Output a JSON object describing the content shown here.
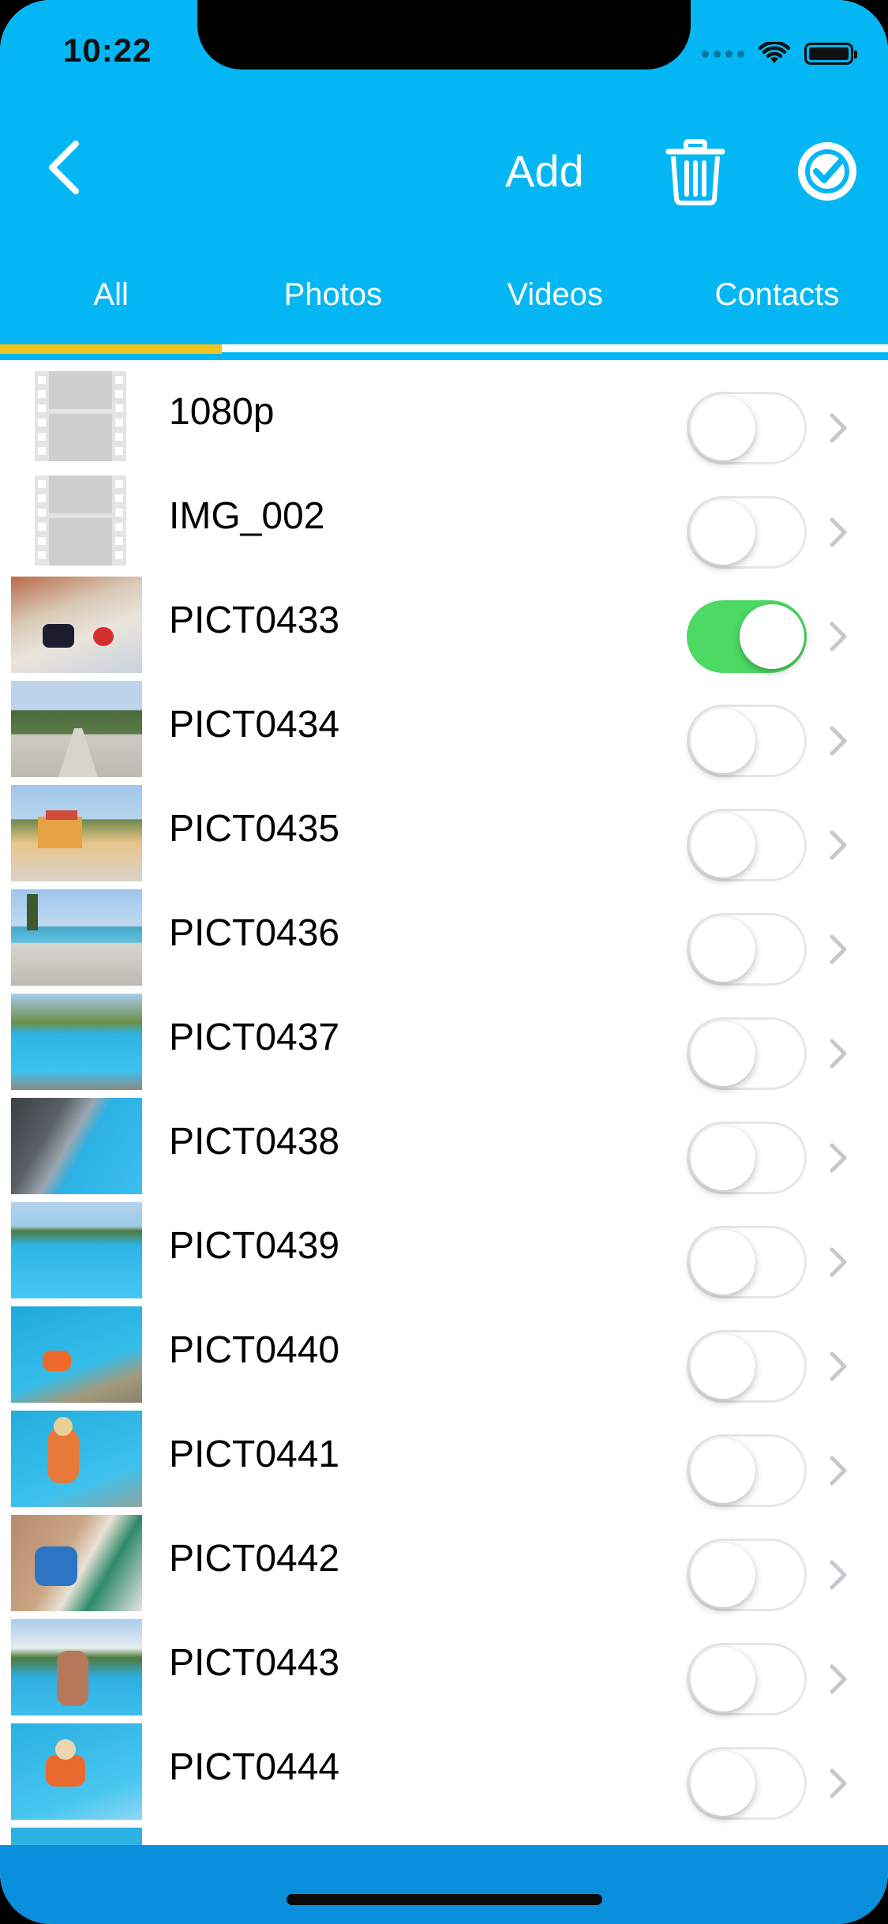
{
  "status_bar": {
    "time": "10:22"
  },
  "nav": {
    "back_icon": "chevron-left-icon",
    "add_label": "Add",
    "trash_icon": "trash-icon",
    "confirm_icon": "check-circle-icon"
  },
  "tabs": [
    {
      "label": "All",
      "selected": true
    },
    {
      "label": "Photos",
      "selected": false
    },
    {
      "label": "Videos",
      "selected": false
    },
    {
      "label": "Contacts",
      "selected": false
    }
  ],
  "items": [
    {
      "label": "1080p",
      "type": "video",
      "enabled": false
    },
    {
      "label": "IMG_002",
      "type": "video",
      "enabled": false
    },
    {
      "label": "PICT0433",
      "type": "photo",
      "enabled": true
    },
    {
      "label": "PICT0434",
      "type": "photo",
      "enabled": false
    },
    {
      "label": "PICT0435",
      "type": "photo",
      "enabled": false
    },
    {
      "label": "PICT0436",
      "type": "photo",
      "enabled": false
    },
    {
      "label": "PICT0437",
      "type": "photo",
      "enabled": false
    },
    {
      "label": "PICT0438",
      "type": "photo",
      "enabled": false
    },
    {
      "label": "PICT0439",
      "type": "photo",
      "enabled": false
    },
    {
      "label": "PICT0440",
      "type": "photo",
      "enabled": false
    },
    {
      "label": "PICT0441",
      "type": "photo",
      "enabled": false
    },
    {
      "label": "PICT0442",
      "type": "photo",
      "enabled": false
    },
    {
      "label": "PICT0443",
      "type": "photo",
      "enabled": false
    },
    {
      "label": "PICT0444",
      "type": "photo",
      "enabled": false
    }
  ],
  "colors": {
    "header": "#04b7f4",
    "tab_indicator": "#f1c422",
    "toggle_on": "#4cd964",
    "bottom_bar": "#0a8fdc"
  }
}
